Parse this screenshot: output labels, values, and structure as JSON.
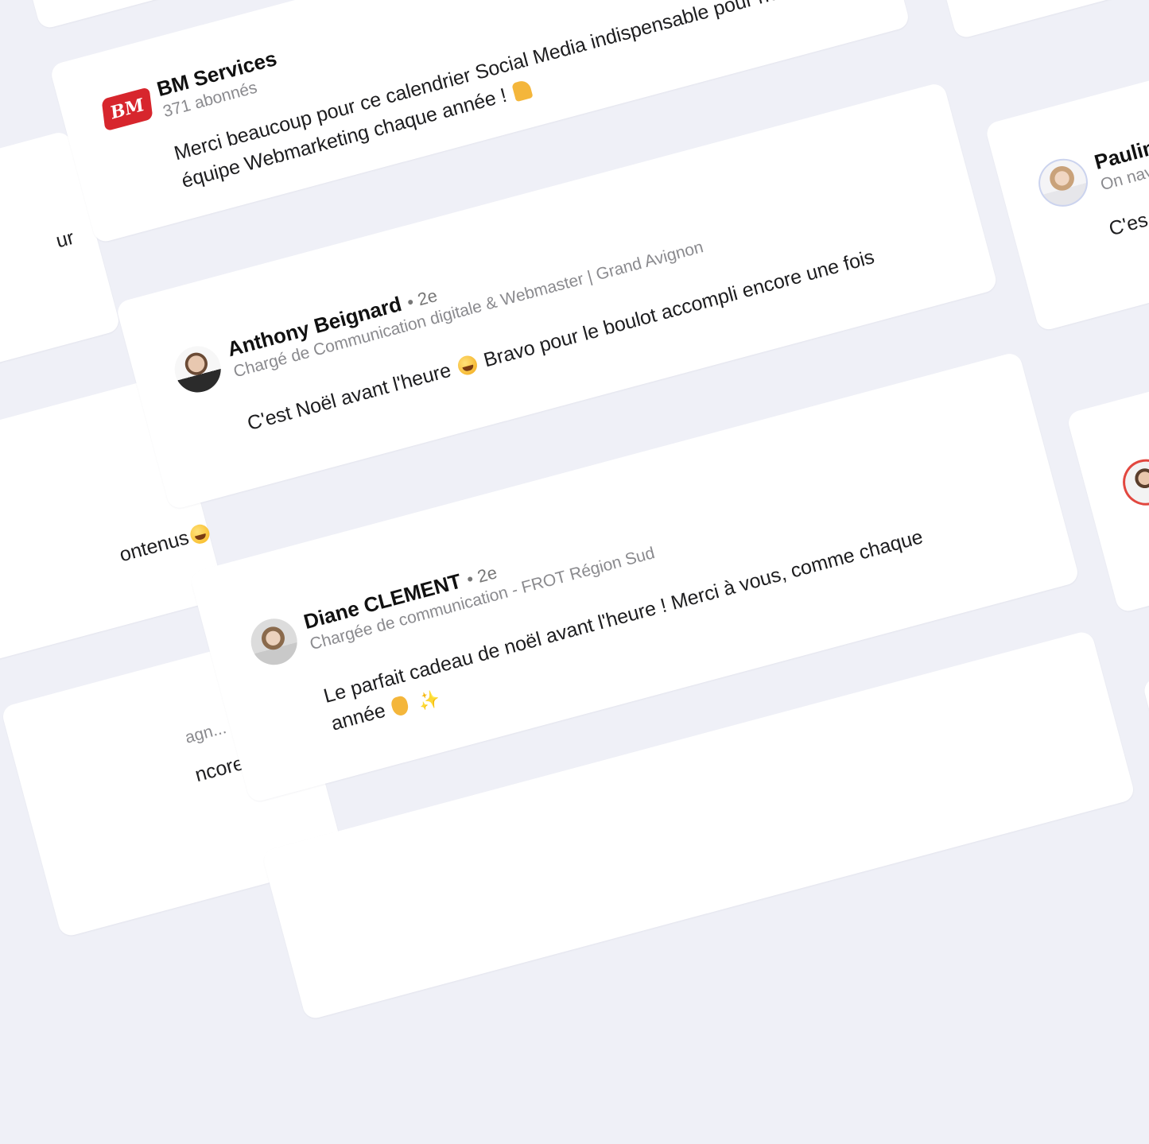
{
  "cards": {
    "bm": {
      "name": "BM Services",
      "meta": "371 abonnés",
      "logo_text": "BM",
      "line1": "Merci beaucoup pour ce calendrier Social Media indispensable pour notre",
      "line2": "équipe Webmarketing chaque année !",
      "emoji": "flexed-biceps"
    },
    "anthony": {
      "name": "Anthony Beignard",
      "degree": "• 2e",
      "title": "Chargé de Communication digitale & Webmaster | Grand Avignon",
      "text_before": "C'est Noël avant l'heure",
      "text_after": "Bravo pour le boulot accompli encore une fois",
      "emoji": "grinning-face"
    },
    "diane": {
      "name": "Diane CLEMENT",
      "degree": "• 2e",
      "title": "Chargée de communication - FROT Région Sud",
      "line1": "Le parfait cadeau de noël avant l'heure ! Merci à vous, comme chaque",
      "line2": "année",
      "emoji": "ok-hand"
    },
    "pauline": {
      "name": "Paulin",
      "title": "On nav",
      "text": "C'es"
    }
  },
  "partial_texts": {
    "left_top": "ur",
    "left_mid": "ontenus",
    "left_bottom_meta": "agn...",
    "left_bottom_text": "ncore que celui"
  },
  "colors": {
    "background": "#eff0f7",
    "card": "#ffffff",
    "bm_brand": "#d7262d",
    "secondary_text": "#8a8a8e"
  }
}
